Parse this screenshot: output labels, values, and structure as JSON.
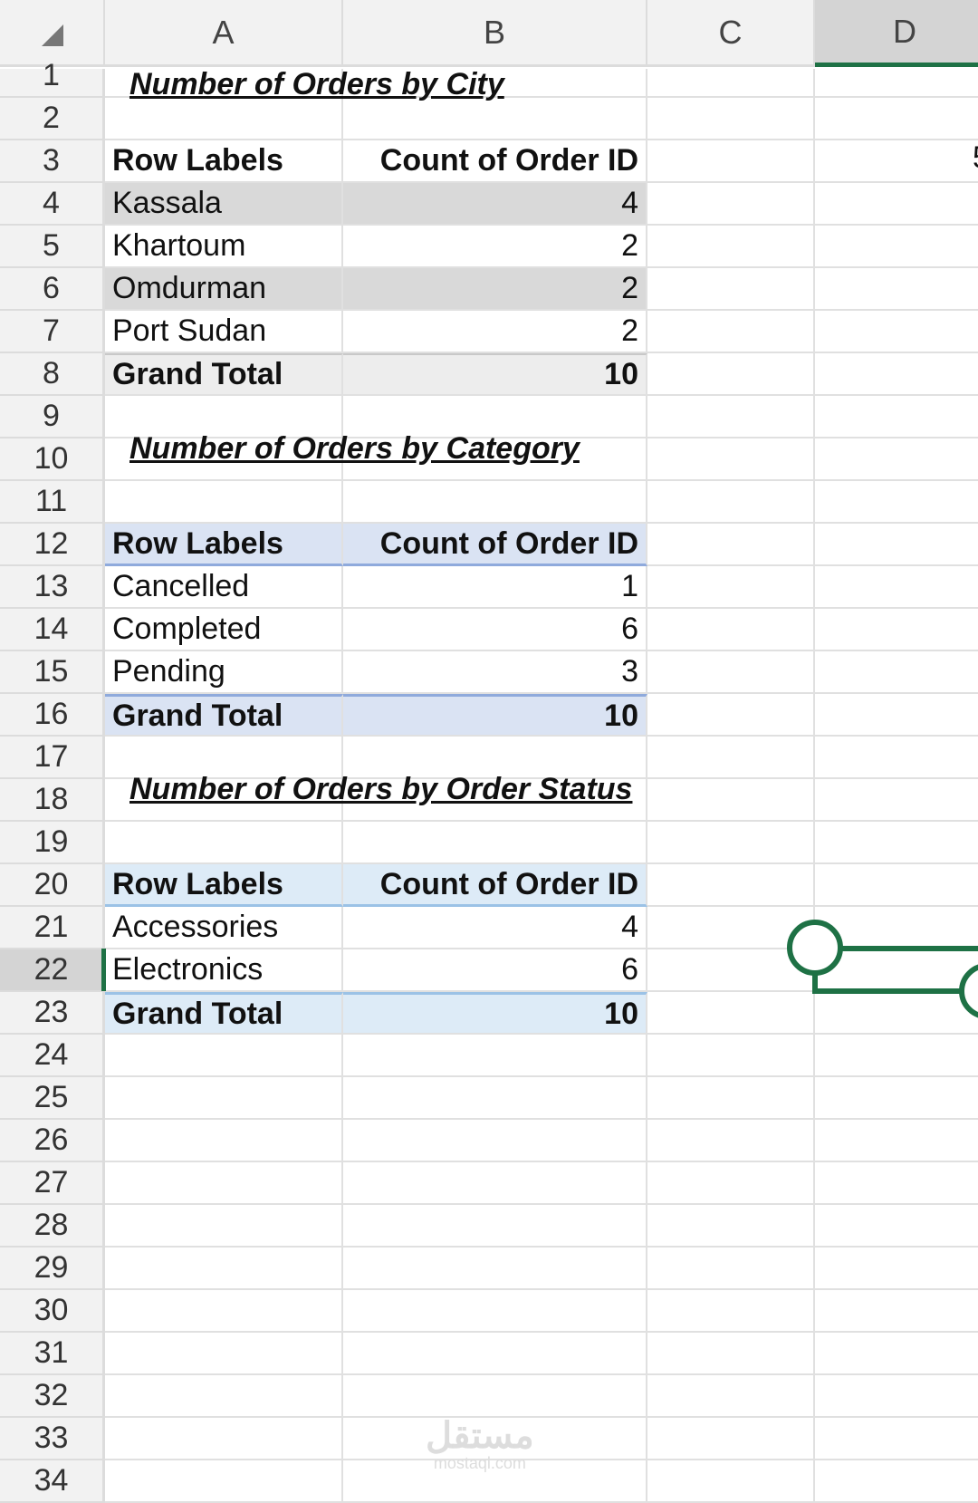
{
  "columns": [
    "A",
    "B",
    "C",
    "D"
  ],
  "selected_column": "D",
  "selected_row": 22,
  "titles": {
    "city": "Number of Orders by City",
    "category": "Number of Orders by Category",
    "status": "Number of Orders by Order Status"
  },
  "rows": [
    {
      "num": "1"
    },
    {
      "num": "2"
    },
    {
      "num": "3",
      "a": "Row Labels",
      "b": "Count of Order ID"
    },
    {
      "num": "4",
      "a": "Kassala",
      "b": "4"
    },
    {
      "num": "5",
      "a": "Khartoum",
      "b": "2"
    },
    {
      "num": "6",
      "a": "Omdurman",
      "b": "2"
    },
    {
      "num": "7",
      "a": "Port Sudan",
      "b": "2"
    },
    {
      "num": "8",
      "a": "Grand Total",
      "b": "10"
    },
    {
      "num": "9"
    },
    {
      "num": "10"
    },
    {
      "num": "11"
    },
    {
      "num": "12",
      "a": "Row Labels",
      "b": "Count of Order ID"
    },
    {
      "num": "13",
      "a": "Cancelled",
      "b": "1"
    },
    {
      "num": "14",
      "a": "Completed",
      "b": "6"
    },
    {
      "num": "15",
      "a": "Pending",
      "b": "3"
    },
    {
      "num": "16",
      "a": "Grand Total",
      "b": "10"
    },
    {
      "num": "17"
    },
    {
      "num": "18"
    },
    {
      "num": "19"
    },
    {
      "num": "20",
      "a": "Row Labels",
      "b": "Count of Order ID"
    },
    {
      "num": "21",
      "a": "Accessories",
      "b": "4"
    },
    {
      "num": "22",
      "a": "Electronics",
      "b": "6"
    },
    {
      "num": "23",
      "a": "Grand Total",
      "b": "10"
    },
    {
      "num": "24"
    },
    {
      "num": "25"
    },
    {
      "num": "26"
    },
    {
      "num": "27"
    },
    {
      "num": "28"
    },
    {
      "num": "29"
    },
    {
      "num": "30"
    },
    {
      "num": "31"
    },
    {
      "num": "32"
    },
    {
      "num": "33"
    },
    {
      "num": "34"
    }
  ],
  "cropped_cell_text": "5",
  "watermark": {
    "arabic": "مستقل",
    "latin": "mostaql.com"
  },
  "colors": {
    "accent": "#1e7145",
    "header_bg": "#f2f2f2"
  }
}
